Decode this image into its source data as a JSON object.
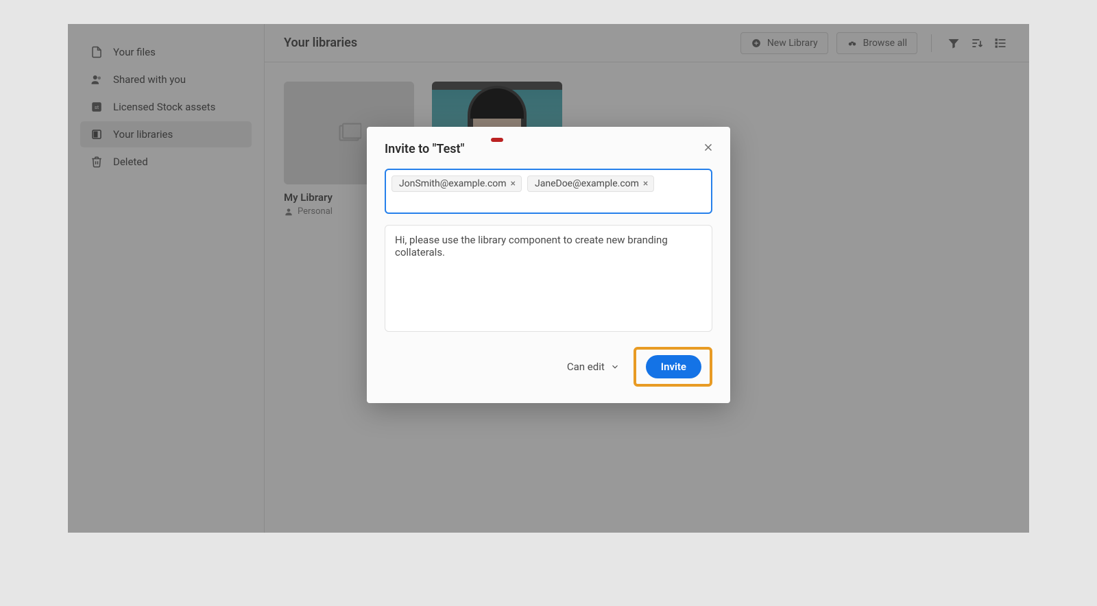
{
  "sidebar": {
    "items": [
      {
        "label": "Your files"
      },
      {
        "label": "Shared with you"
      },
      {
        "label": "Licensed Stock assets"
      },
      {
        "label": "Your libraries"
      },
      {
        "label": "Deleted"
      }
    ]
  },
  "header": {
    "title": "Your libraries",
    "new_library": "New Library",
    "browse_all": "Browse all"
  },
  "cards": [
    {
      "title": "My Library",
      "meta": "Personal"
    }
  ],
  "dialog": {
    "title": "Invite to \"Test\"",
    "emails": [
      "JonSmith@example.com",
      "JaneDoe@example.com"
    ],
    "message": "Hi, please use the library component to create new branding collaterals.",
    "permission": "Can edit",
    "invite": "Invite"
  }
}
